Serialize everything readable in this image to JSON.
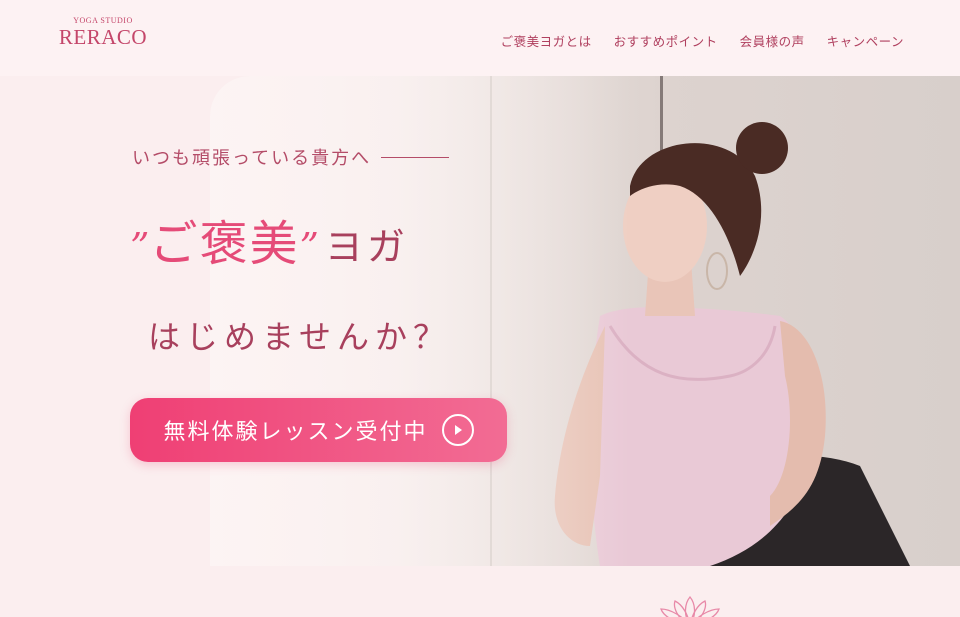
{
  "header": {
    "logo_sub": "YOGA STUDIO",
    "logo_main": "RERACO",
    "nav": [
      {
        "label": "ご褒美ヨガとは"
      },
      {
        "label": "おすすめポイント"
      },
      {
        "label": "会員様の声"
      },
      {
        "label": "キャンペーン"
      }
    ]
  },
  "hero": {
    "tagline": "いつも頑張っている貴方へ",
    "quote_open": "”",
    "title_highlight": "ご褒美",
    "quote_close": "”",
    "title_rest": "ヨガ",
    "title_line2": "はじめませんか？",
    "cta_label": "無料体験レッスン受付中"
  },
  "colors": {
    "accent": "#e54b78",
    "text": "#a8405d",
    "background": "#fbeeef",
    "cta_start": "#ef3f74",
    "cta_end": "#f26c94"
  },
  "icons": {
    "cta": "play-circle-icon",
    "decor": "lotus-icon"
  }
}
